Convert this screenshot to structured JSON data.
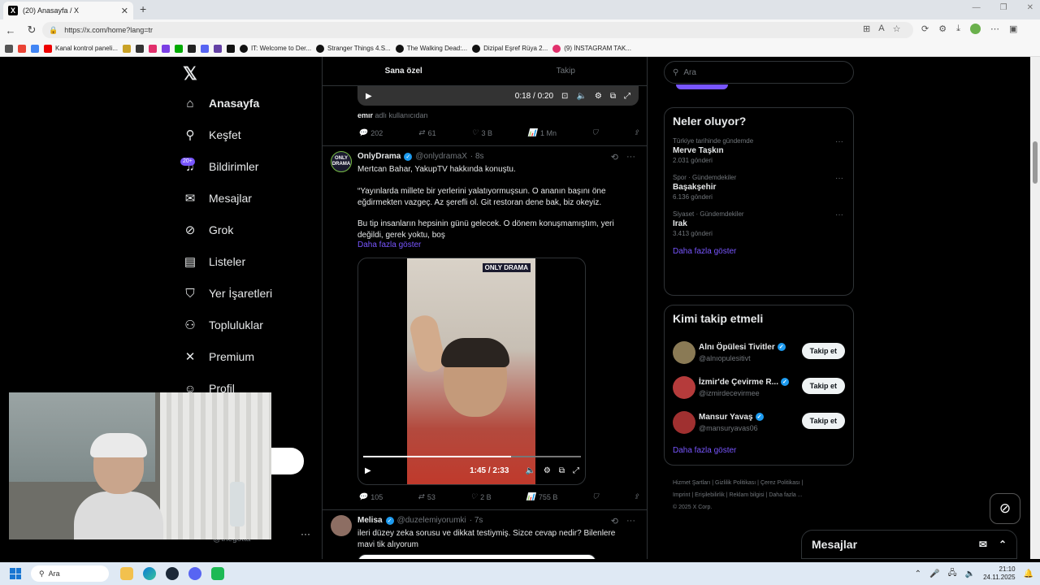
{
  "browser": {
    "tab_title": "(20) Anasayfa / X",
    "url": "https://x.com/home?lang=tr",
    "bookmarks": [
      "Kanal kontrol paneli...",
      "IT: Welcome to Der...",
      "Stranger Things 4.S...",
      "The Walking Dead:...",
      "Dizipal Eşref Rüya 2...",
      "(9) İNSTAGRAM TAK..."
    ]
  },
  "nav": {
    "items": [
      {
        "label": "Anasayfa",
        "icon": "home-icon"
      },
      {
        "label": "Keşfet",
        "icon": "search-icon"
      },
      {
        "label": "Bildirimler",
        "icon": "bell-icon"
      },
      {
        "label": "Mesajlar",
        "icon": "mail-icon"
      },
      {
        "label": "Grok",
        "icon": "grok-icon"
      },
      {
        "label": "Listeler",
        "icon": "list-icon"
      },
      {
        "label": "Yer İşaretleri",
        "icon": "bookmark-icon"
      },
      {
        "label": "Topluluklar",
        "icon": "communities-icon"
      },
      {
        "label": "Premium",
        "icon": "x-icon"
      },
      {
        "label": "Profil",
        "icon": "profile-icon"
      }
    ],
    "notif_badge": "20+",
    "account_handle": "@thegotta"
  },
  "feed": {
    "tabs": [
      "Sana özel",
      "Takip"
    ],
    "prev_post": {
      "video_time": "0:18 / 0:20",
      "caption_user": "emır",
      "caption_rest": " adlı kullanıcıdan",
      "replies": "202",
      "reposts": "61",
      "likes": "3 B",
      "views": "1 Mn"
    },
    "post1": {
      "name": "OnlyDrama",
      "handle": "@onlydramaX",
      "time": "· 8s",
      "line1": "Mertcan Bahar, YakupTV hakkında konuştu.",
      "line2": "“Yayınlarda millete bir yerlerini yalatıyormuşsun. O ananın başını öne eğdirmekten vazgeç. Az şerefli ol. Git restoran dene bak, biz okeyiz.",
      "line3": "Bu tip insanların hepsinin günü gelecek. O dönem konuşmamıştım, yeri değildi, gerek yoktu, boş",
      "more": "Daha fazla göster",
      "video_logo": "ONLY DRAMA",
      "video_time": "1:45 / 2:33",
      "video_progress": 0.68,
      "replies": "105",
      "reposts": "53",
      "likes": "2 B",
      "views": "755 B"
    },
    "post2": {
      "name": "Melisa",
      "handle": "@duzelemiyorumki",
      "time": "· 7s",
      "text": "ileri düzey zeka sorusu ve dikkat testiymiş. Sizce cevap nedir? Bilenlere mavi tik alıyorum"
    }
  },
  "right": {
    "search_placeholder": "Ara",
    "trends_title": "Neler oluyor?",
    "trends": [
      {
        "context": "Türkiye tarihinde gündemde",
        "title": "Merve Taşkın",
        "count": "2.031 gönderi"
      },
      {
        "context": "Spor · Gündemdekiler",
        "title": "Başakşehir",
        "count": "6.136 gönderi"
      },
      {
        "context": "Siyaset · Gündemdekiler",
        "title": "Irak",
        "count": "3.413 gönderi"
      }
    ],
    "show_more": "Daha fazla göster",
    "who_title": "Kimi takip etmeli",
    "who": [
      {
        "name": "Alnı Öpülesi Tivitler",
        "handle": "@alnıopulesitivt",
        "color": "#8a7a55"
      },
      {
        "name": "İzmir'de Çevirme R...",
        "handle": "@izmirdecevirmee",
        "color": "#b53b3b"
      },
      {
        "name": "Mansur Yavaş",
        "handle": "@mansuryavas06",
        "color": "#a03030"
      }
    ],
    "follow_label": "Takip et",
    "footer": [
      "Hizmet Şartları",
      "|",
      "Gizlilik Politikası",
      "|",
      "Çerez Politikası",
      "|",
      "Imprint",
      "|",
      "Erişilebilirlik",
      "|",
      "Reklam bilgisi",
      "|",
      "Daha fazla ...",
      "© 2025 X Corp."
    ],
    "messages_label": "Mesajlar"
  },
  "taskbar": {
    "search": "Ara",
    "time": "21:10",
    "date": "24.11.2025"
  },
  "colors": {
    "accent": "#7856ff",
    "verified": "#1d9bf0"
  }
}
